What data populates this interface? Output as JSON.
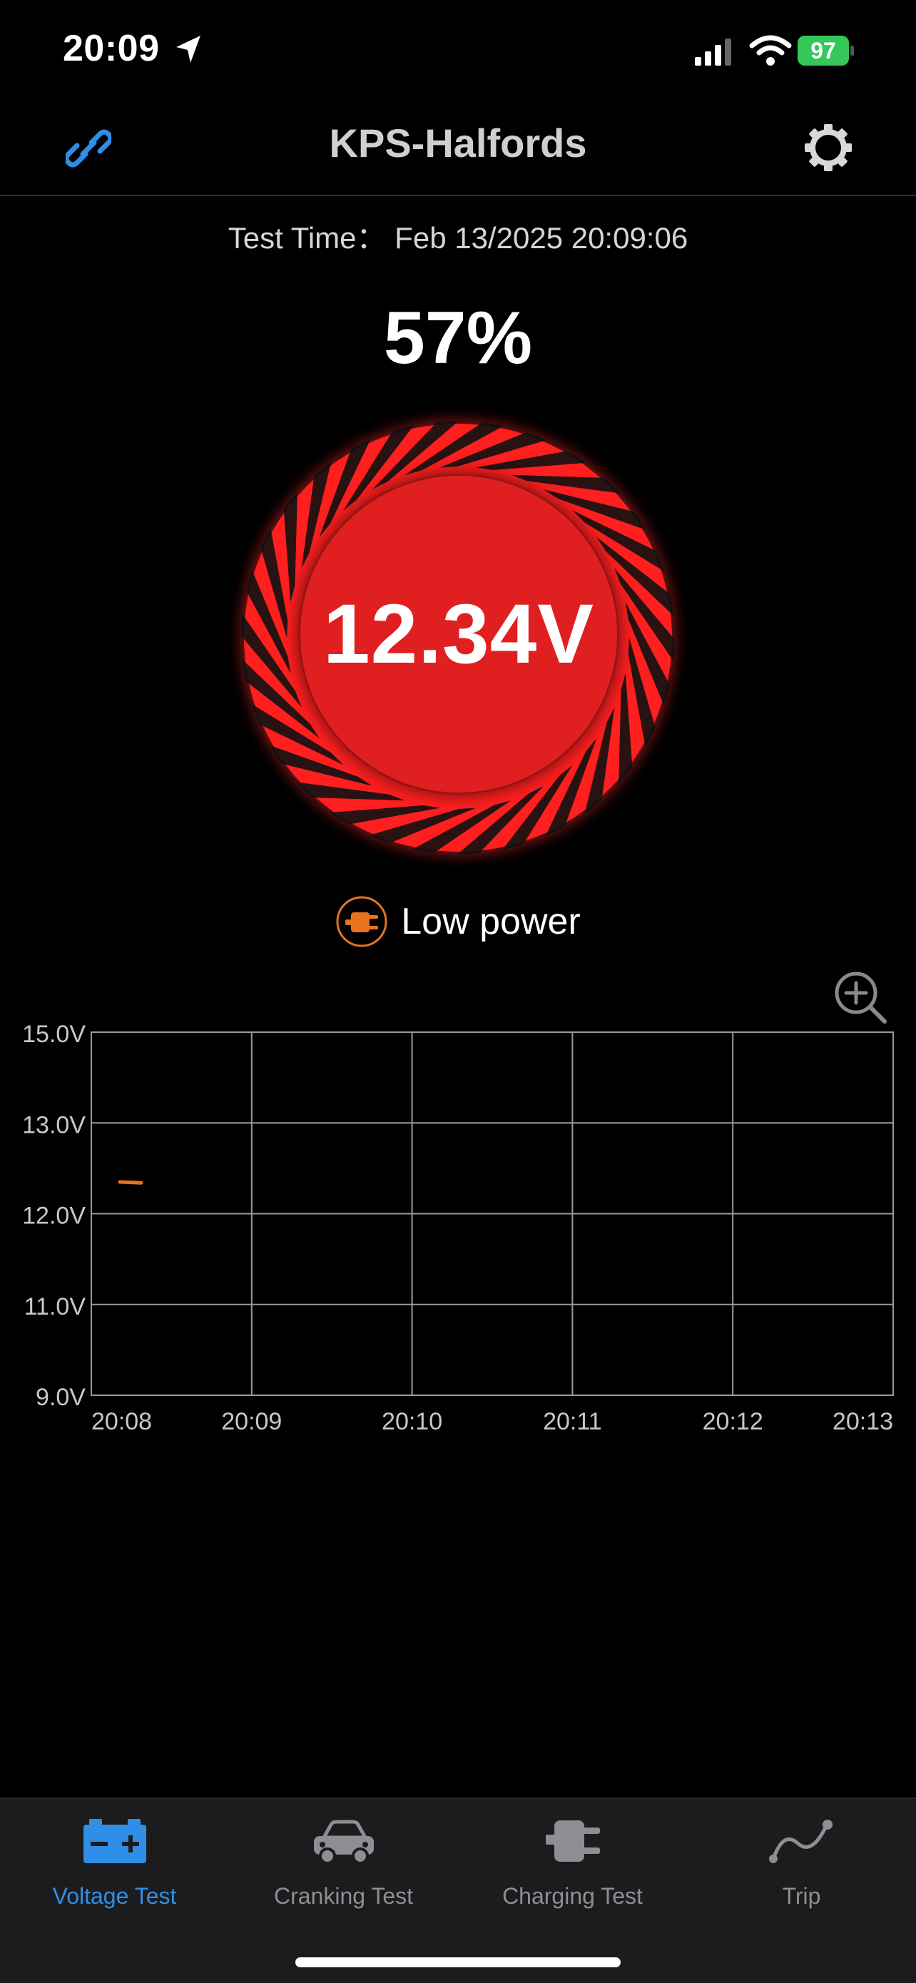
{
  "status_bar": {
    "time": "20:09",
    "battery": "97"
  },
  "header": {
    "title": "KPS-Halfords"
  },
  "test_time": "Test Time： Feb 13/2025 20:09:06",
  "gauge": {
    "percent": "57%",
    "voltage": "12.34V"
  },
  "status": {
    "text": "Low power"
  },
  "colors": {
    "accent": "#2f8fe6",
    "gauge_red": "#e02020",
    "warning_orange": "#e8731c",
    "battery_green": "#34c759"
  },
  "chart_data": {
    "type": "line",
    "y_ticks": [
      "15.0V",
      "13.0V",
      "12.0V",
      "11.0V",
      "9.0V"
    ],
    "x_ticks": [
      "20:08",
      "20:09",
      "20:10",
      "20:11",
      "20:12",
      "20:13"
    ],
    "series": [
      {
        "values": [
          {
            "x": "20:08",
            "y": 12.35
          },
          {
            "x": "20:08",
            "y": 12.34
          }
        ],
        "color": "#e8731c"
      }
    ]
  },
  "tabs": [
    {
      "label": "Voltage Test",
      "icon": "battery-icon",
      "active": true
    },
    {
      "label": "Cranking Test",
      "icon": "car-icon",
      "active": false
    },
    {
      "label": "Charging Test",
      "icon": "plug-icon",
      "active": false
    },
    {
      "label": "Trip",
      "icon": "trip-icon",
      "active": false
    }
  ]
}
